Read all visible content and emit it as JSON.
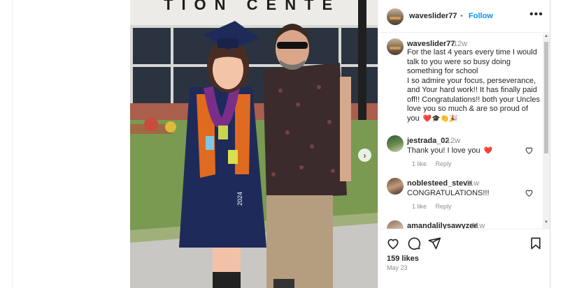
{
  "post": {
    "username": "waveslider77",
    "dot": "•",
    "follow_label": "Follow",
    "more_label": "•••",
    "caption_time": "12w",
    "caption_text": "For the last 4 years every time I would talk to you were so busy doing something for school\nI so admire your focus, perseverance, and Your hard work!! It has finally paid off!! Congratulations!! both your Uncles love you so much & are so proud of you",
    "caption_emojis": "❤️🎓👏🎉",
    "likes": "159 likes",
    "date": "May 23"
  },
  "photo": {
    "sign_text": "TION CENTE",
    "cap_year": "2024"
  },
  "comments": [
    {
      "user": "jestrada_02",
      "time": "12w",
      "text": "Thank you! I love you",
      "emoji": "❤️",
      "likes": "1 like",
      "reply": "Reply"
    },
    {
      "user": "noblesteed_steve",
      "time": "11w",
      "text": "CONGRATULATIONS!!!",
      "likes": "1 like",
      "reply": "Reply"
    },
    {
      "user": "amandalilysawyzee",
      "time": "11w"
    }
  ],
  "icons": {
    "like": "heart-icon",
    "comment": "comment-icon",
    "share": "send-icon",
    "save": "bookmark-icon",
    "next": "chevron-right-icon"
  },
  "colors": {
    "follow": "#0095f6",
    "text": "#262626",
    "muted": "#8e8e8e",
    "heart": "#ed4956"
  }
}
